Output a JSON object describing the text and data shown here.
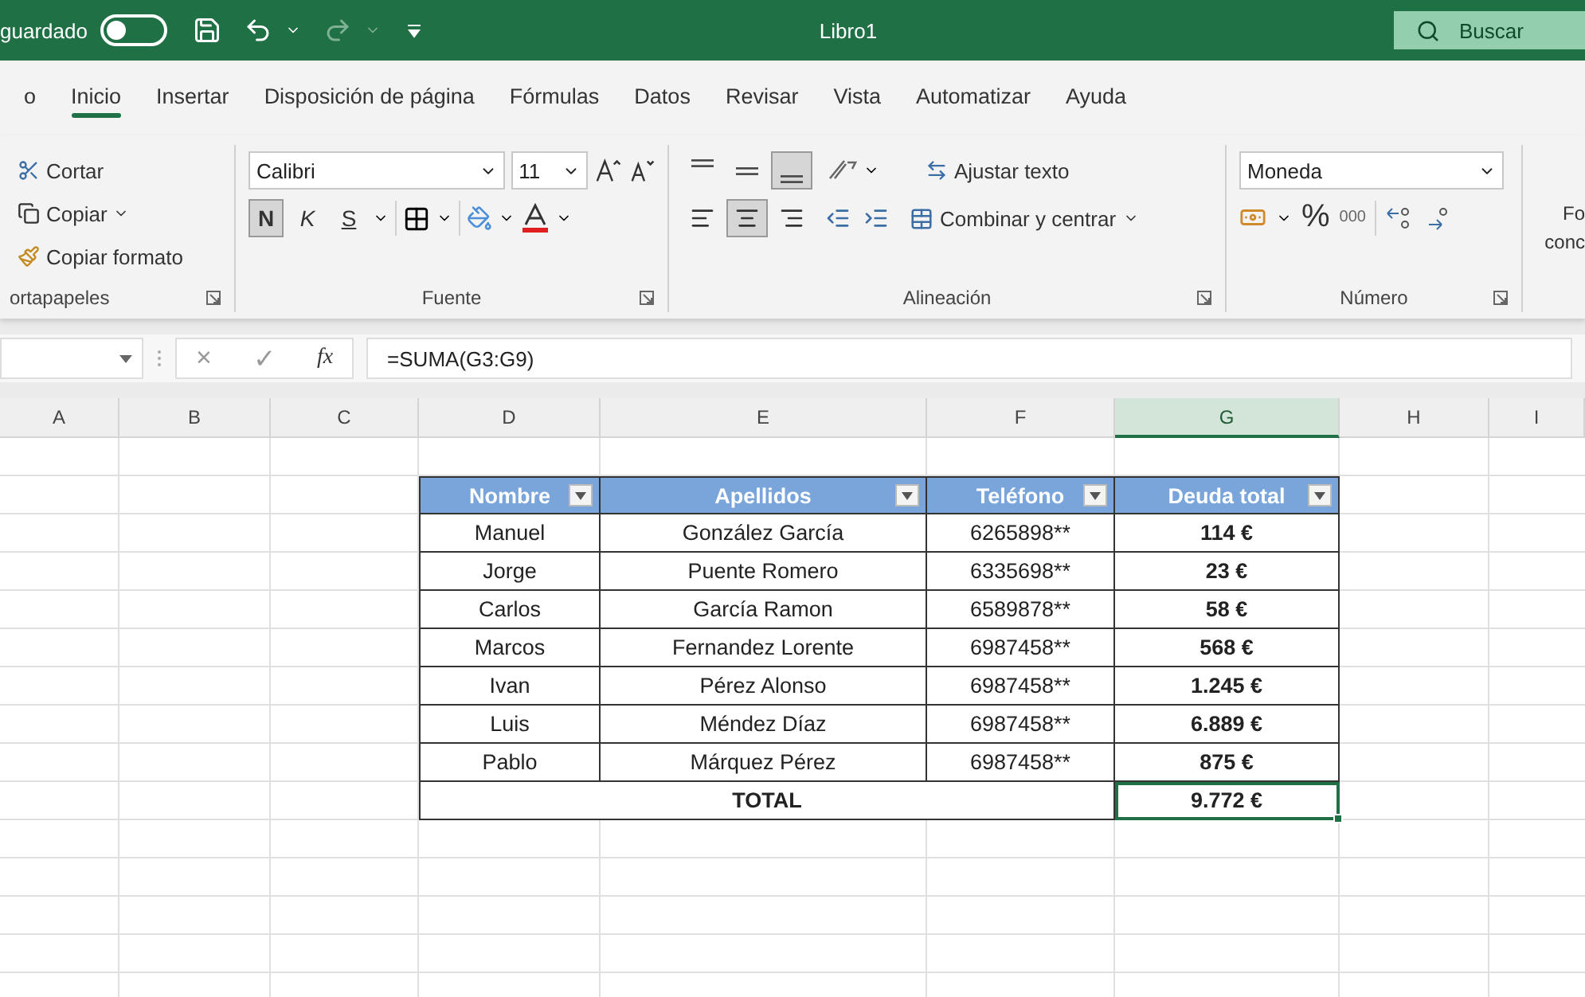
{
  "title_bar": {
    "autosave_label": "guardado",
    "autosave_on": false,
    "title": "Libro1",
    "search": {
      "placeholder": "Buscar"
    }
  },
  "tabs": [
    {
      "label": "o",
      "selected": false
    },
    {
      "label": "Inicio",
      "selected": true
    },
    {
      "label": "Insertar",
      "selected": false
    },
    {
      "label": "Disposición de página",
      "selected": false
    },
    {
      "label": "Fórmulas",
      "selected": false
    },
    {
      "label": "Datos",
      "selected": false
    },
    {
      "label": "Revisar",
      "selected": false
    },
    {
      "label": "Vista",
      "selected": false
    },
    {
      "label": "Automatizar",
      "selected": false
    },
    {
      "label": "Ayuda",
      "selected": false
    }
  ],
  "ribbon": {
    "clipboard": {
      "cut": "Cortar",
      "copy": "Copiar",
      "format_painter": "Copiar formato",
      "label": "ortapapeles"
    },
    "font": {
      "name": "Calibri",
      "size": "11",
      "bold": {
        "label": "N",
        "pressed": true
      },
      "italic": "K",
      "underline": "S",
      "label": "Fuente"
    },
    "alignment": {
      "buttons": [
        {
          "kind": "top",
          "pressed": false
        },
        {
          "kind": "middle",
          "pressed": false
        },
        {
          "kind": "bottom",
          "pressed": true
        },
        {
          "kind": "left",
          "pressed": false
        },
        {
          "kind": "center",
          "pressed": true
        },
        {
          "kind": "right",
          "pressed": false
        }
      ],
      "wrap": "Ajustar texto",
      "merge": "Combinar y centrar",
      "label": "Alineación"
    },
    "number": {
      "format": "Moneda",
      "percent": "%",
      "thousands": "000",
      "label": "Número"
    },
    "styles": {
      "lines": [
        "Fo",
        "conc"
      ]
    }
  },
  "formula_bar": {
    "cancel": "×",
    "enter": "✓",
    "fx": "fx",
    "formula": "=SUMA(G3:G9)"
  },
  "sheet": {
    "columns": [
      {
        "label": "A",
        "selected": false
      },
      {
        "label": "B",
        "selected": false
      },
      {
        "label": "C",
        "selected": false
      },
      {
        "label": "D",
        "selected": false
      },
      {
        "label": "E",
        "selected": false
      },
      {
        "label": "F",
        "selected": false
      },
      {
        "label": "G",
        "selected": true
      },
      {
        "label": "H",
        "selected": false
      },
      {
        "label": "I",
        "selected": false
      }
    ],
    "table": {
      "headers": [
        "Nombre",
        "Apellidos",
        "Teléfono",
        "Deuda total"
      ],
      "rows": [
        [
          "Manuel",
          "González García",
          "6265898**",
          "114 €"
        ],
        [
          "Jorge",
          "Puente Romero",
          "6335698**",
          "23 €"
        ],
        [
          "Carlos",
          "García Ramon",
          "6589878**",
          "58 €"
        ],
        [
          "Marcos",
          "Fernandez Lorente",
          "6987458**",
          "568 €"
        ],
        [
          "Ivan",
          "Pérez Alonso",
          "6987458**",
          "1.245 €"
        ],
        [
          "Luis",
          "Méndez Díaz",
          "6987458**",
          "6.889 €"
        ],
        [
          "Pablo",
          "Márquez Pérez",
          "6987458**",
          "875 €"
        ]
      ],
      "total": {
        "label": "TOTAL",
        "value": "9.772 €",
        "selected": true
      }
    }
  }
}
